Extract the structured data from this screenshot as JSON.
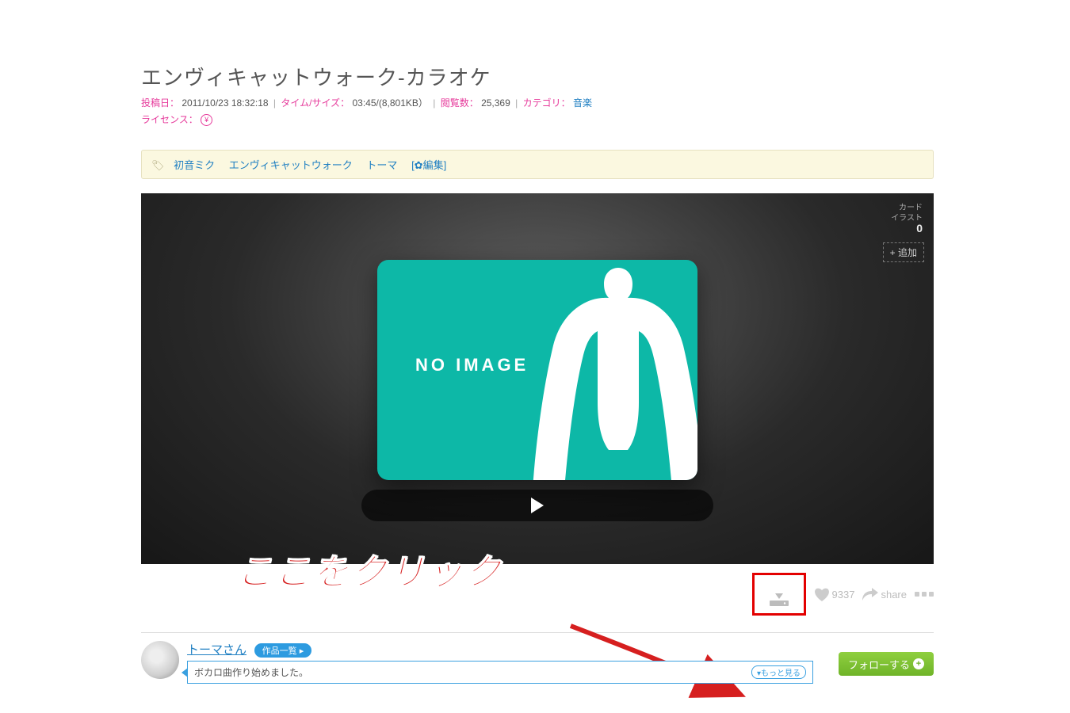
{
  "title": "エンヴィキャットウォーク-カラオケ",
  "meta": {
    "posted_label": "投稿日：",
    "posted_value": "2011/10/23 18:32:18",
    "time_label": "タイム/サイズ：",
    "time_value": "03:45/(8,801KB）",
    "views_label": "閲覧数：",
    "views_value": "25,369",
    "category_label": "カテゴリ：",
    "category_value": "音楽",
    "license_label": "ライセンス："
  },
  "tags": {
    "items": [
      "初音ミク",
      "エンヴィキャットウォーク",
      "トーマ"
    ],
    "edit_label": "[✿編集]"
  },
  "player": {
    "card_label_line1": "カード",
    "card_label_line2": "イラスト",
    "card_count": "0",
    "add_label": "+ 追加",
    "noimage": "NO IMAGE"
  },
  "annotation": {
    "text": "ここをクリック"
  },
  "actions": {
    "like_count": "9337",
    "share_label": "share"
  },
  "author": {
    "name": "トーマさん",
    "works_badge": "作品一覧 ▸",
    "bio": "ボカロ曲作り始めました。",
    "more_label": "▾もっと見る",
    "follow_label": "フォローする"
  }
}
